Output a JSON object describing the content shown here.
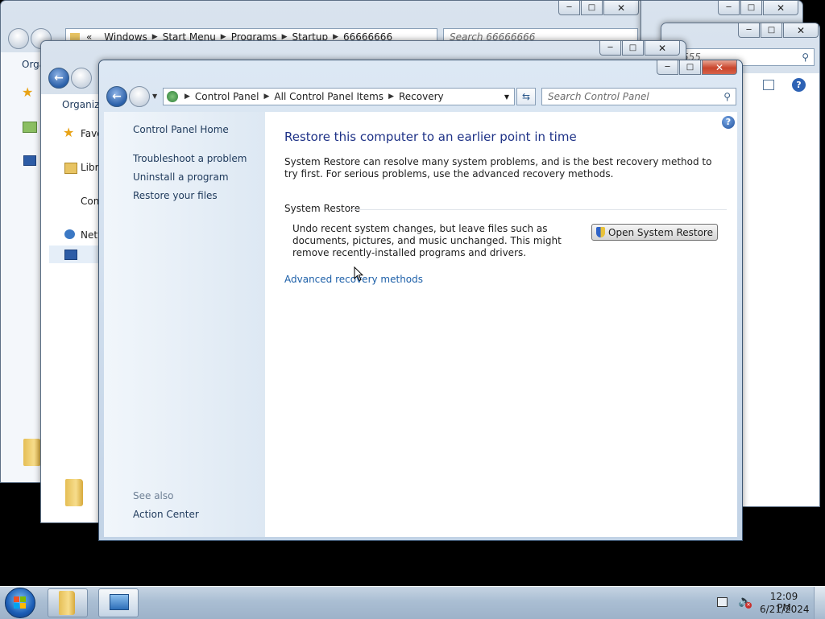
{
  "back_window_1": {
    "breadcrumb_overflow": "«",
    "breadcrumb": [
      "Windows",
      "Start Menu",
      "Programs",
      "Startup",
      "66666666"
    ],
    "search_placeholder": "Search 66666666",
    "toolbar_organize": "Orga"
  },
  "back_window_2": {
    "search_placeholder_fragment": "555"
  },
  "back_window_3": {
    "toolbar_organize": "Organize",
    "nav_items": [
      "Favo",
      "Libra",
      "Com",
      "Netw"
    ]
  },
  "main_window": {
    "breadcrumb": [
      "Control Panel",
      "All Control Panel Items",
      "Recovery"
    ],
    "search_placeholder": "Search Control Panel",
    "sidebar": {
      "home": "Control Panel Home",
      "links": [
        "Troubleshoot a problem",
        "Uninstall a program",
        "Restore your files"
      ],
      "see_also_label": "See also",
      "see_also_links": [
        "Action Center"
      ]
    },
    "main": {
      "title": "Restore this computer to an earlier point in time",
      "description": "System Restore can resolve many system problems, and is the best recovery method to try first. For serious problems, use the advanced recovery methods.",
      "section_title": "System Restore",
      "section_text": "Undo recent system changes, but leave files such as documents, pictures, and music unchanged. This might remove recently-installed programs and drivers.",
      "button_label": "Open System Restore",
      "advanced_link": "Advanced recovery methods"
    }
  },
  "taskbar": {
    "time": "12:09 PM",
    "date": "6/21/2024"
  },
  "colors": {
    "link": "#1c5fa8",
    "title": "#1e3287",
    "sidebar_bg": "#e8f0f8"
  }
}
